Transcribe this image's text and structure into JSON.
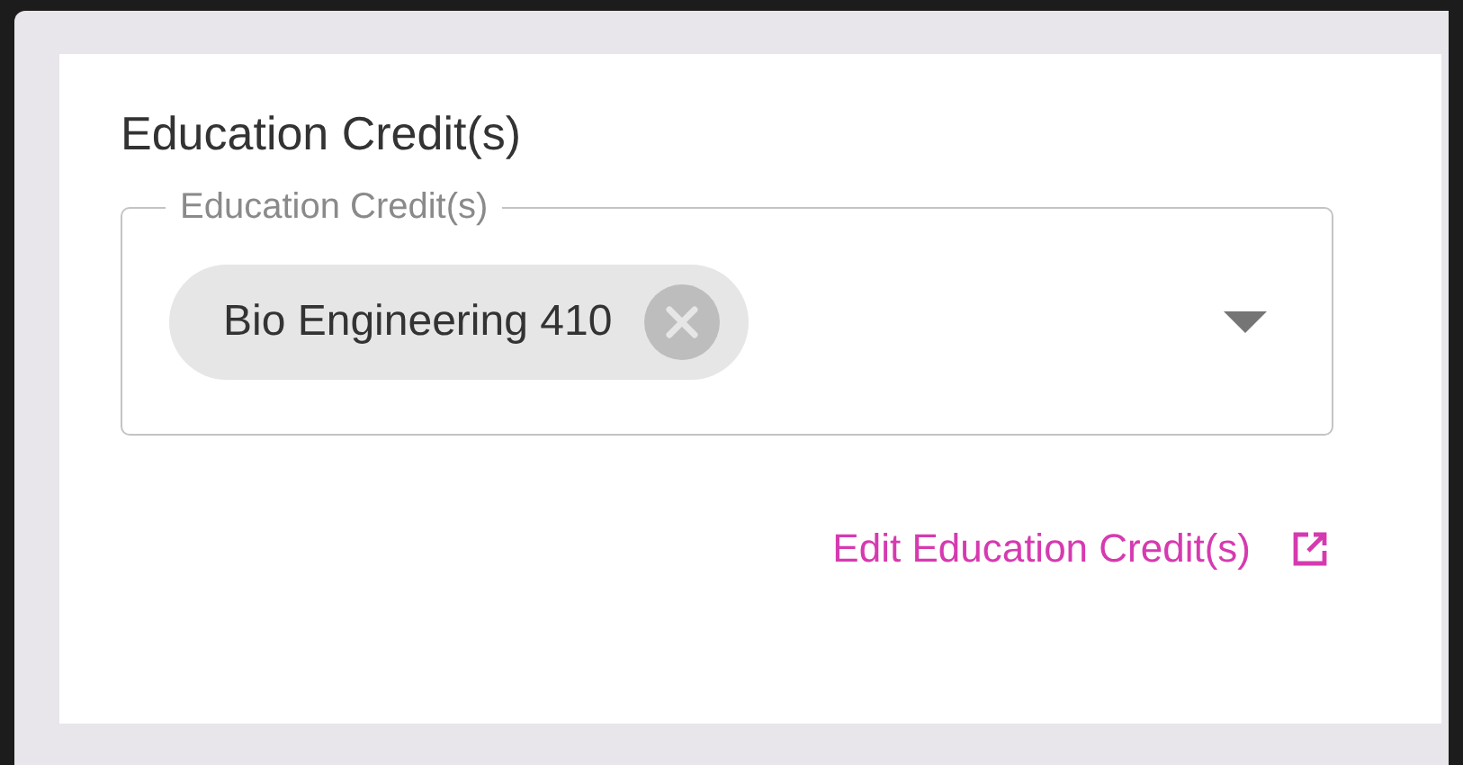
{
  "section": {
    "title": "Education Credit(s)"
  },
  "field": {
    "label": "Education Credit(s)",
    "chips": [
      {
        "label": "Bio Engineering 410"
      }
    ]
  },
  "link": {
    "label": "Edit Education Credit(s)"
  }
}
